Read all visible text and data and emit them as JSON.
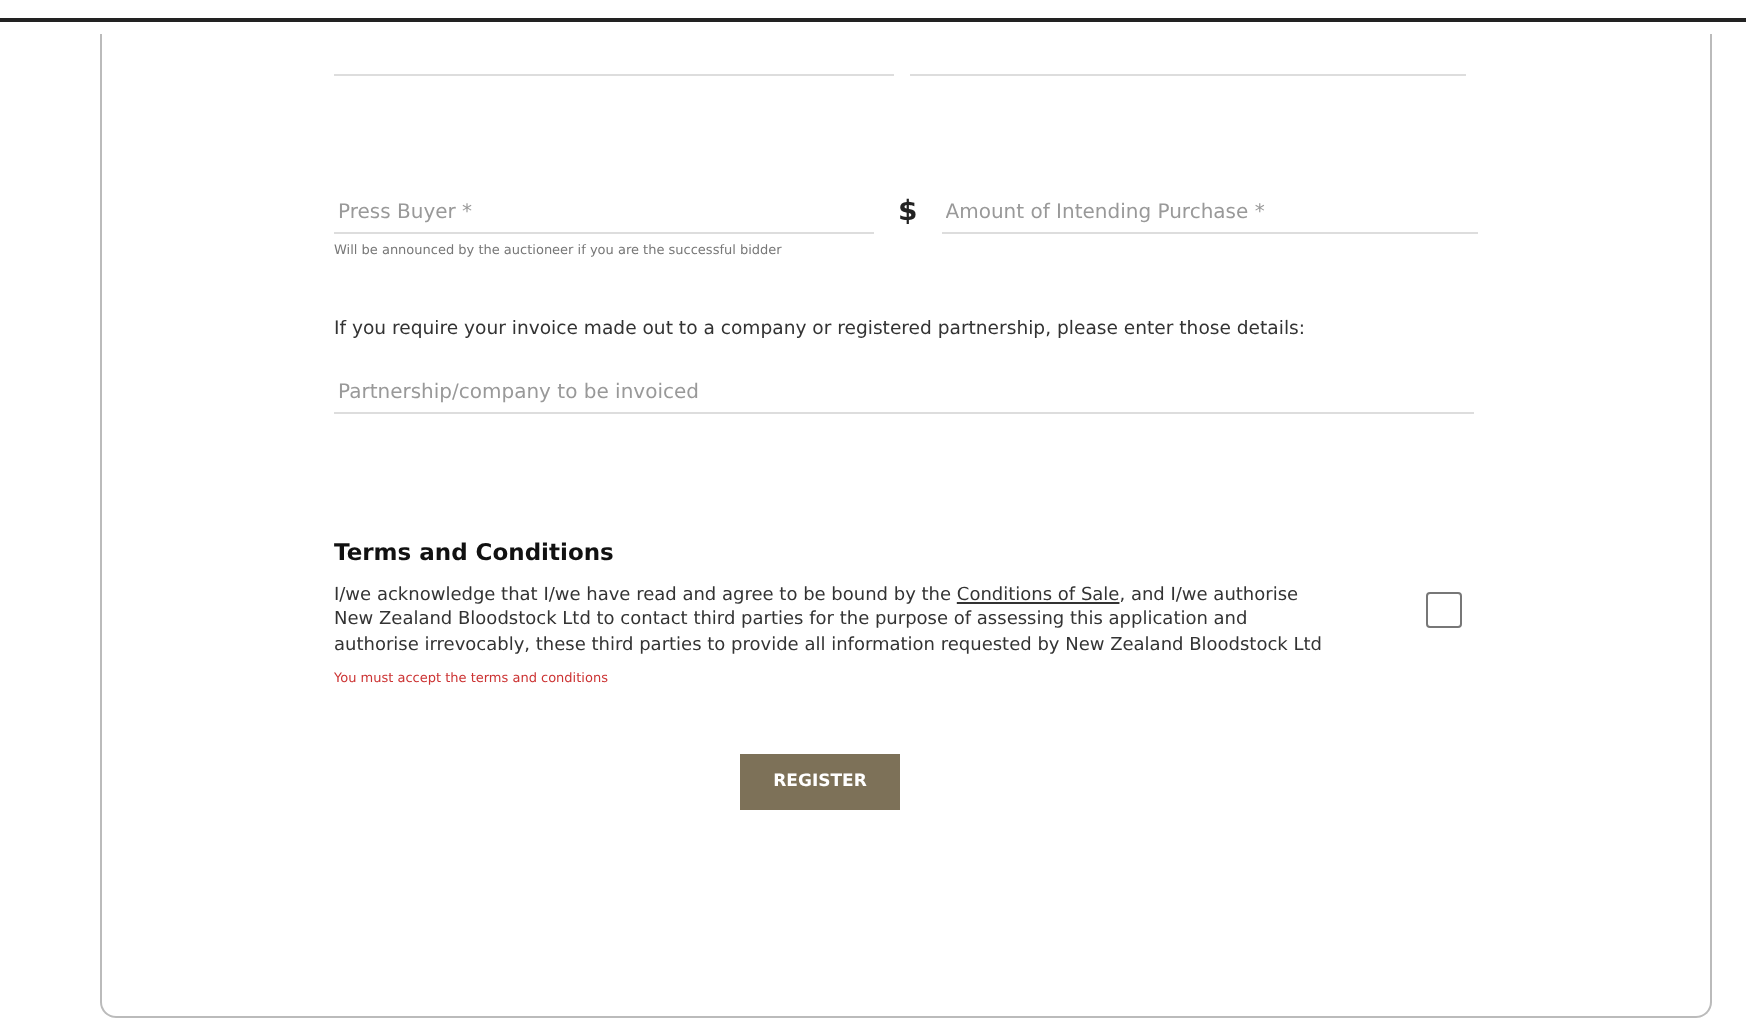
{
  "top_fields": [
    {
      "kind": "cut_off"
    },
    {
      "kind": "cut_off"
    }
  ],
  "press_buyer": {
    "placeholder": "Press Buyer *",
    "hint": "Will be announced by the auctioneer if you are the successful bidder"
  },
  "amount": {
    "currency_symbol": "$",
    "placeholder": "Amount of Intending Purchase *"
  },
  "invoice_note": "If you require your invoice made out to a company or registered partnership, please enter those details:",
  "company": {
    "placeholder": "Partnership/company to be invoiced"
  },
  "terms": {
    "heading": "Terms and Conditions",
    "text_before": "I/we acknowledge that I/we have read and agree to be bound by the ",
    "link": "Conditions of Sale",
    "text_after": ", and I/we authorise New Zealand Bloodstock Ltd to contact third parties for the purpose of assessing this application and authorise irrevocably, these third parties to provide all information requested by New Zealand Bloodstock Ltd",
    "checked": false,
    "error": "You must accept the terms and conditions"
  },
  "register_button": "REGISTER"
}
